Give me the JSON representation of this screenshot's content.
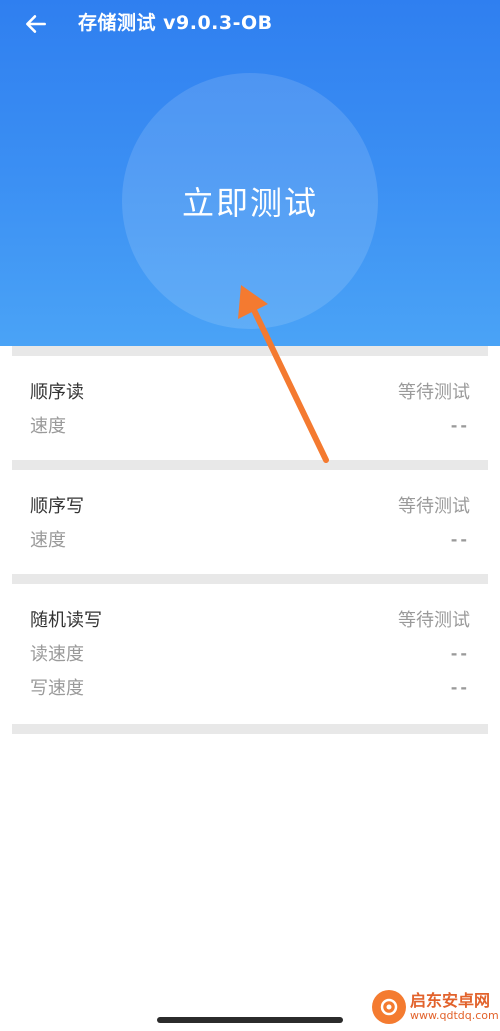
{
  "header": {
    "title": "存储测试 v9.0.3-OB",
    "back_icon": "arrow-left-icon",
    "background": "#3b8ff3"
  },
  "start_button": {
    "label": "立即测试"
  },
  "tests": [
    {
      "name": "顺序读",
      "status": "等待测试",
      "metrics": [
        {
          "label": "速度",
          "value": "--"
        }
      ]
    },
    {
      "name": "顺序写",
      "status": "等待测试",
      "metrics": [
        {
          "label": "速度",
          "value": "--"
        }
      ]
    },
    {
      "name": "随机读写",
      "status": "等待测试",
      "metrics": [
        {
          "label": "读速度",
          "value": "--"
        },
        {
          "label": "写速度",
          "value": "--"
        }
      ]
    }
  ],
  "annotation": {
    "icon": "orange-arrow-icon",
    "color": "#f47a30"
  },
  "watermark": {
    "main": "启东安卓网",
    "sub": "www.qdtdq.com",
    "color": "#e2622b"
  }
}
